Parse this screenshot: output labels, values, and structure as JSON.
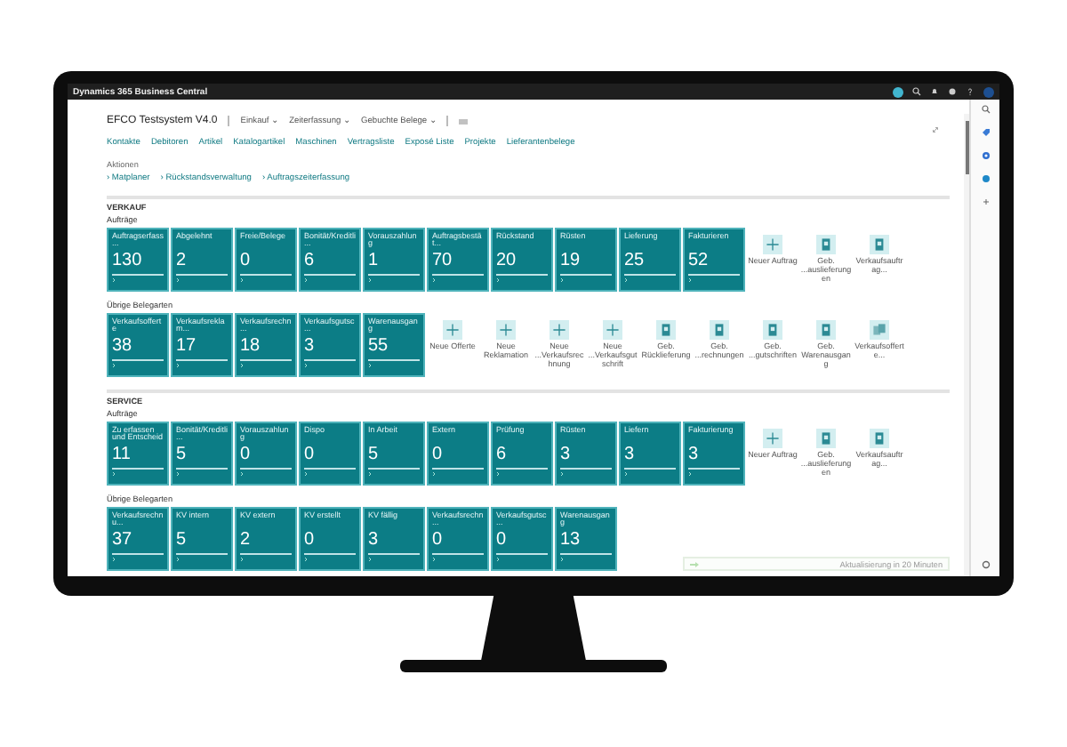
{
  "window": {
    "title": "Dynamics 365 Business Central"
  },
  "header": {
    "company": "EFCO Testsystem V4.0",
    "menus": [
      {
        "label": "Einkauf ⌄"
      },
      {
        "label": "Zeiterfassung ⌄"
      },
      {
        "label": "Gebuchte Belege ⌄"
      }
    ],
    "links": [
      "Kontakte",
      "Debitoren",
      "Artikel",
      "Katalogartikel",
      "Maschinen",
      "Vertragsliste",
      "Exposé Liste",
      "Projekte",
      "Lieferantenbelege"
    ]
  },
  "actions": {
    "title": "Aktionen",
    "items": [
      "› Matplaner",
      "› Rückstandsverwaltung",
      "› Auftragszeiterfassung"
    ]
  },
  "sections": [
    {
      "title": "VERKAUF",
      "groups": [
        {
          "title": "Aufträge",
          "tiles": [
            {
              "label": "Auftragserfass...",
              "value": "130"
            },
            {
              "label": "Abgelehnt",
              "value": "2"
            },
            {
              "label": "Freie/Belege",
              "value": "0"
            },
            {
              "label": "Bonität/Kreditli...",
              "value": "6"
            },
            {
              "label": "Vorauszahlung",
              "value": "1"
            },
            {
              "label": "Auftragsbestät...",
              "value": "70"
            },
            {
              "label": "Rückstand",
              "value": "20"
            },
            {
              "label": "Rüsten",
              "value": "19"
            },
            {
              "label": "Lieferung",
              "value": "25"
            },
            {
              "label": "Fakturieren",
              "value": "52"
            }
          ],
          "shortcuts": [
            {
              "kind": "new",
              "label": "Neuer Auftrag"
            },
            {
              "kind": "doc",
              "label": "Geb. ...auslieferungen"
            },
            {
              "kind": "doc",
              "label": "Verkaufsauftrag..."
            }
          ]
        },
        {
          "title": "Übrige Belegarten",
          "tiles": [
            {
              "label": "Verkaufsofferte",
              "value": "38"
            },
            {
              "label": "Verkaufsreklam...",
              "value": "17"
            },
            {
              "label": "Verkaufsrechn...",
              "value": "18"
            },
            {
              "label": "Verkaufsgutsc...",
              "value": "3"
            },
            {
              "label": "Warenausgang",
              "value": "55"
            }
          ],
          "shortcuts": [
            {
              "kind": "new",
              "label": "Neue Offerte"
            },
            {
              "kind": "new",
              "label": "Neue Reklamation"
            },
            {
              "kind": "new",
              "label": "Neue ...Verkaufsrechnung"
            },
            {
              "kind": "new",
              "label": "Neue ...Verkaufsgutschrift"
            },
            {
              "kind": "doc",
              "label": "Geb. Rücklieferung"
            },
            {
              "kind": "doc",
              "label": "Geb. ...rechnungen"
            },
            {
              "kind": "doc",
              "label": "Geb. ...gutschriften"
            },
            {
              "kind": "doc",
              "label": "Geb. Warenausgang"
            },
            {
              "kind": "pages",
              "label": "Verkaufsofferte..."
            }
          ]
        }
      ]
    },
    {
      "title": "SERVICE",
      "groups": [
        {
          "title": "Aufträge",
          "tiles": [
            {
              "label": "Zu erfassen und Entscheid",
              "value": "11"
            },
            {
              "label": "Bonität/Kreditli...",
              "value": "5"
            },
            {
              "label": "Vorauszahlung",
              "value": "0"
            },
            {
              "label": "Dispo",
              "value": "0"
            },
            {
              "label": "In Arbeit",
              "value": "5"
            },
            {
              "label": "Extern",
              "value": "0"
            },
            {
              "label": "Prüfung",
              "value": "6"
            },
            {
              "label": "Rüsten",
              "value": "3"
            },
            {
              "label": "Liefern",
              "value": "3"
            },
            {
              "label": "Fakturierung",
              "value": "3"
            }
          ],
          "shortcuts": [
            {
              "kind": "new",
              "label": "Neuer Auftrag"
            },
            {
              "kind": "doc",
              "label": "Geb. ...auslieferungen"
            },
            {
              "kind": "doc",
              "label": "Verkaufsauftrag..."
            }
          ]
        },
        {
          "title": "Übrige Belegarten",
          "tiles": [
            {
              "label": "Verkaufsrechnu...",
              "value": "37"
            },
            {
              "label": "KV intern",
              "value": "5"
            },
            {
              "label": "KV extern",
              "value": "2"
            },
            {
              "label": "KV erstellt",
              "value": "0"
            },
            {
              "label": "KV fällig",
              "value": "3"
            },
            {
              "label": "Verkaufsrechn...",
              "value": "0"
            },
            {
              "label": "Verkaufsgutsc...",
              "value": "0"
            },
            {
              "label": "Warenausgang",
              "value": "13"
            }
          ]
        }
      ]
    }
  ],
  "notification": {
    "text": "Aktualisierung in 20 Minuten"
  }
}
